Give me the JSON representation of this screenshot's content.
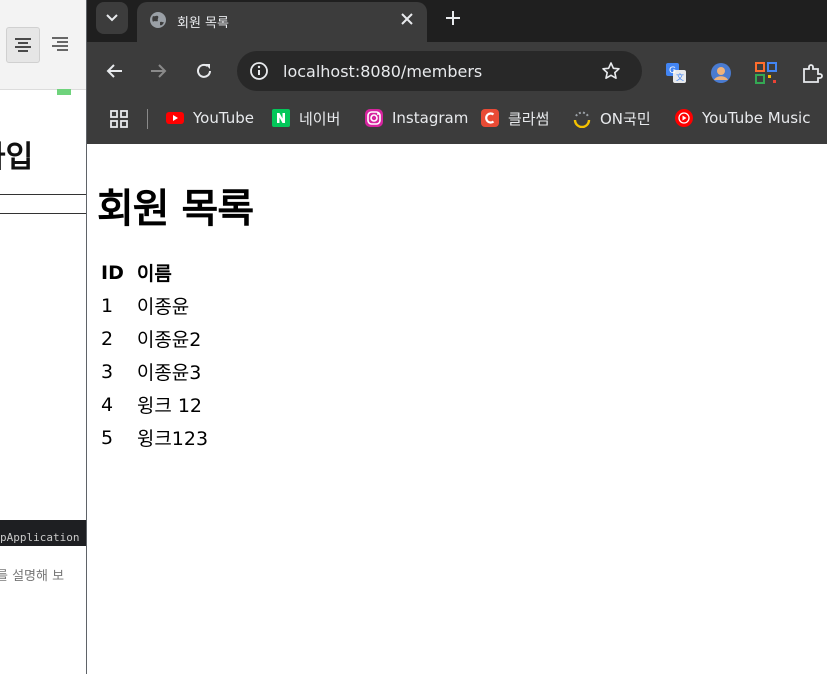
{
  "background_window": {
    "heading_fragment": "가입",
    "console_text": "pApplication",
    "hint_text": "를 설명해 보"
  },
  "tab": {
    "title": "회원 목록",
    "close_icon": "close-icon"
  },
  "address_bar": {
    "url": "localhost:8080/members"
  },
  "bookmarks": [
    {
      "label": "YouTube",
      "icon": "youtube-icon",
      "color": "#ff0000"
    },
    {
      "label": "네이버",
      "icon": "naver-icon",
      "color": "#03c75a"
    },
    {
      "label": "Instagram",
      "icon": "instagram-icon",
      "color": "#d6249f"
    },
    {
      "label": "클라썸",
      "icon": "classum-icon",
      "color": "#e94b35"
    },
    {
      "label": "ON국민",
      "icon": "on-kookmin-icon",
      "color": "#f5c200"
    },
    {
      "label": "YouTube Music",
      "icon": "youtube-music-icon",
      "color": "#ff0000"
    }
  ],
  "page": {
    "title": "회원 목록",
    "table": {
      "headers": [
        "ID",
        "이름"
      ],
      "rows": [
        [
          "1",
          "이종윤"
        ],
        [
          "2",
          "이종윤2"
        ],
        [
          "3",
          "이종윤3"
        ],
        [
          "4",
          "윙크 12"
        ],
        [
          "5",
          "윙크123"
        ]
      ]
    }
  },
  "colors": {
    "tabstrip": "#1f1f1f",
    "toolbar": "#3c3c3c",
    "omnibox": "#282828"
  }
}
